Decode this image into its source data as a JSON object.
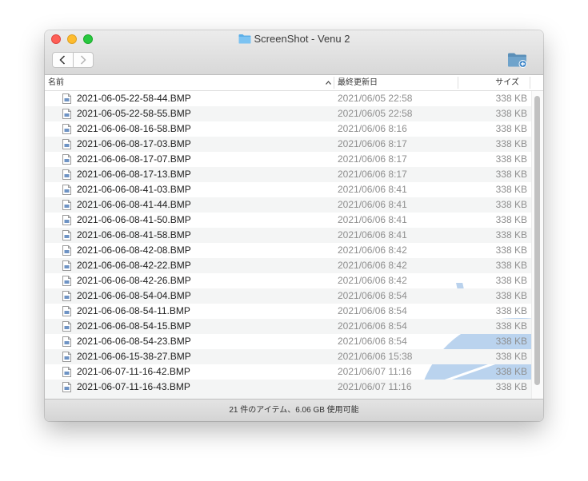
{
  "window": {
    "title": "ScreenShot - Venu 2"
  },
  "toolbar": {
    "back_icon": "chevron-left-icon",
    "forward_icon": "chevron-right-icon",
    "new_folder_icon": "new-folder-icon"
  },
  "columns": {
    "name": "名前",
    "date": "最終更新日",
    "size": "サイズ",
    "sort_icon": "chevron-up-icon"
  },
  "files": [
    {
      "name": "2021-06-05-22-58-44.BMP",
      "date": "2021/06/05 22:58",
      "size": "338 KB"
    },
    {
      "name": "2021-06-05-22-58-55.BMP",
      "date": "2021/06/05 22:58",
      "size": "338 KB"
    },
    {
      "name": "2021-06-06-08-16-58.BMP",
      "date": "2021/06/06 8:16",
      "size": "338 KB"
    },
    {
      "name": "2021-06-06-08-17-03.BMP",
      "date": "2021/06/06 8:17",
      "size": "338 KB"
    },
    {
      "name": "2021-06-06-08-17-07.BMP",
      "date": "2021/06/06 8:17",
      "size": "338 KB"
    },
    {
      "name": "2021-06-06-08-17-13.BMP",
      "date": "2021/06/06 8:17",
      "size": "338 KB"
    },
    {
      "name": "2021-06-06-08-41-03.BMP",
      "date": "2021/06/06 8:41",
      "size": "338 KB"
    },
    {
      "name": "2021-06-06-08-41-44.BMP",
      "date": "2021/06/06 8:41",
      "size": "338 KB"
    },
    {
      "name": "2021-06-06-08-41-50.BMP",
      "date": "2021/06/06 8:41",
      "size": "338 KB"
    },
    {
      "name": "2021-06-06-08-41-58.BMP",
      "date": "2021/06/06 8:41",
      "size": "338 KB"
    },
    {
      "name": "2021-06-06-08-42-08.BMP",
      "date": "2021/06/06 8:42",
      "size": "338 KB"
    },
    {
      "name": "2021-06-06-08-42-22.BMP",
      "date": "2021/06/06 8:42",
      "size": "338 KB"
    },
    {
      "name": "2021-06-06-08-42-26.BMP",
      "date": "2021/06/06 8:42",
      "size": "338 KB"
    },
    {
      "name": "2021-06-06-08-54-04.BMP",
      "date": "2021/06/06 8:54",
      "size": "338 KB"
    },
    {
      "name": "2021-06-06-08-54-11.BMP",
      "date": "2021/06/06 8:54",
      "size": "338 KB"
    },
    {
      "name": "2021-06-06-08-54-15.BMP",
      "date": "2021/06/06 8:54",
      "size": "338 KB"
    },
    {
      "name": "2021-06-06-08-54-23.BMP",
      "date": "2021/06/06 8:54",
      "size": "338 KB"
    },
    {
      "name": "2021-06-06-15-38-27.BMP",
      "date": "2021/06/06 15:38",
      "size": "338 KB"
    },
    {
      "name": "2021-06-07-11-16-42.BMP",
      "date": "2021/06/07 11:16",
      "size": "338 KB"
    },
    {
      "name": "2021-06-07-11-16-43.BMP",
      "date": "2021/06/07 11:16",
      "size": "338 KB"
    }
  ],
  "status": {
    "text": "21 件のアイテム、6.06 GB 使用可能"
  },
  "colors": {
    "close": "#fe5f57",
    "minimize": "#febc2e",
    "maximize": "#28c840",
    "folder": "#5aaee8",
    "watermark": "#aecbeb"
  }
}
